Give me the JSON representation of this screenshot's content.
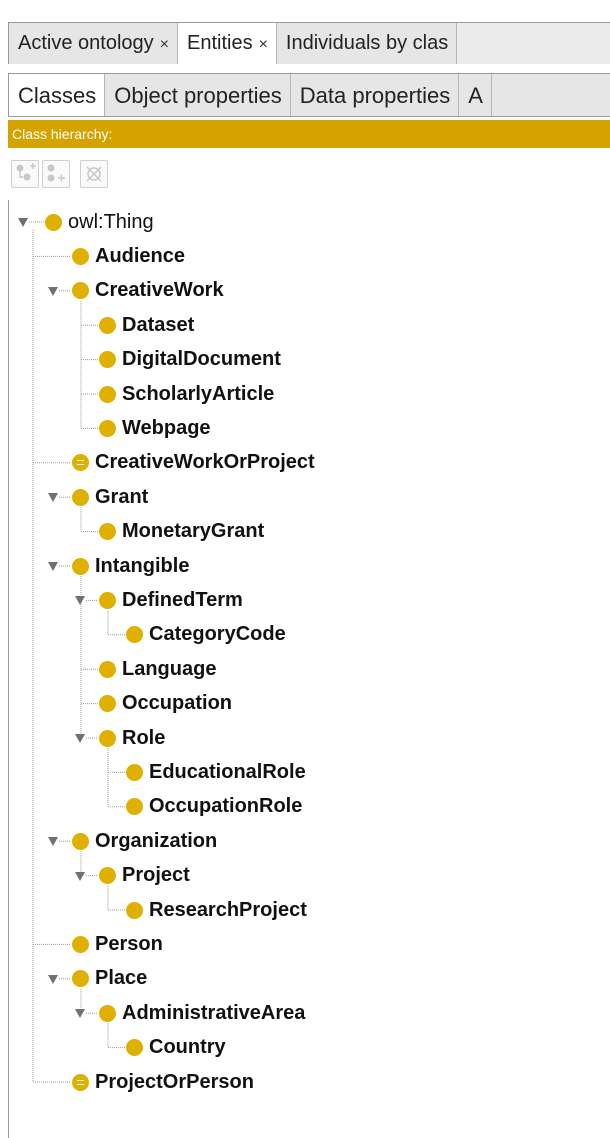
{
  "tabs": [
    {
      "label": "Active ontology",
      "close": "×"
    },
    {
      "label": "Entities",
      "close": "×",
      "active": true
    },
    {
      "label": "Individuals by clas",
      "close": ""
    }
  ],
  "subtabs": [
    {
      "label": "Classes",
      "active": true
    },
    {
      "label": "Object properties"
    },
    {
      "label": "Data properties"
    },
    {
      "label": "A"
    }
  ],
  "hierarchy_header": "Class hierarchy:",
  "toolbar": {
    "buttons": [
      {
        "name": "add-subclass",
        "icon": "add-subclass-icon"
      },
      {
        "name": "add-sibling",
        "icon": "add-sibling-icon"
      },
      {
        "name": "delete-class",
        "icon": "delete-class-icon"
      }
    ]
  },
  "tree": [
    {
      "label": "owl:Thing",
      "depth": 0,
      "expanded": true,
      "bold": false,
      "equiv": false
    },
    {
      "label": "Audience",
      "depth": 1,
      "expanded": false,
      "bold": true,
      "equiv": false
    },
    {
      "label": "CreativeWork",
      "depth": 1,
      "expanded": true,
      "bold": true,
      "equiv": false
    },
    {
      "label": "Dataset",
      "depth": 2,
      "expanded": false,
      "bold": true,
      "equiv": false
    },
    {
      "label": "DigitalDocument",
      "depth": 2,
      "expanded": false,
      "bold": true,
      "equiv": false
    },
    {
      "label": "ScholarlyArticle",
      "depth": 2,
      "expanded": false,
      "bold": true,
      "equiv": false
    },
    {
      "label": "Webpage",
      "depth": 2,
      "expanded": false,
      "bold": true,
      "equiv": false
    },
    {
      "label": "CreativeWorkOrProject",
      "depth": 1,
      "expanded": false,
      "bold": true,
      "equiv": true
    },
    {
      "label": "Grant",
      "depth": 1,
      "expanded": true,
      "bold": true,
      "equiv": false
    },
    {
      "label": "MonetaryGrant",
      "depth": 2,
      "expanded": false,
      "bold": true,
      "equiv": false
    },
    {
      "label": "Intangible",
      "depth": 1,
      "expanded": true,
      "bold": true,
      "equiv": false
    },
    {
      "label": "DefinedTerm",
      "depth": 2,
      "expanded": true,
      "bold": true,
      "equiv": false
    },
    {
      "label": "CategoryCode",
      "depth": 3,
      "expanded": false,
      "bold": true,
      "equiv": false
    },
    {
      "label": "Language",
      "depth": 2,
      "expanded": false,
      "bold": true,
      "equiv": false
    },
    {
      "label": "Occupation",
      "depth": 2,
      "expanded": false,
      "bold": true,
      "equiv": false
    },
    {
      "label": "Role",
      "depth": 2,
      "expanded": true,
      "bold": true,
      "equiv": false
    },
    {
      "label": "EducationalRole",
      "depth": 3,
      "expanded": false,
      "bold": true,
      "equiv": false
    },
    {
      "label": "OccupationRole",
      "depth": 3,
      "expanded": false,
      "bold": true,
      "equiv": false
    },
    {
      "label": "Organization",
      "depth": 1,
      "expanded": true,
      "bold": true,
      "equiv": false
    },
    {
      "label": "Project",
      "depth": 2,
      "expanded": true,
      "bold": true,
      "equiv": false
    },
    {
      "label": "ResearchProject",
      "depth": 3,
      "expanded": false,
      "bold": true,
      "equiv": false
    },
    {
      "label": "Person",
      "depth": 1,
      "expanded": false,
      "bold": true,
      "equiv": false
    },
    {
      "label": "Place",
      "depth": 1,
      "expanded": true,
      "bold": true,
      "equiv": false
    },
    {
      "label": "AdministrativeArea",
      "depth": 2,
      "expanded": true,
      "bold": true,
      "equiv": false
    },
    {
      "label": "Country",
      "depth": 3,
      "expanded": false,
      "bold": true,
      "equiv": false
    },
    {
      "label": "ProjectOrPerson",
      "depth": 1,
      "expanded": false,
      "bold": true,
      "equiv": true
    }
  ]
}
